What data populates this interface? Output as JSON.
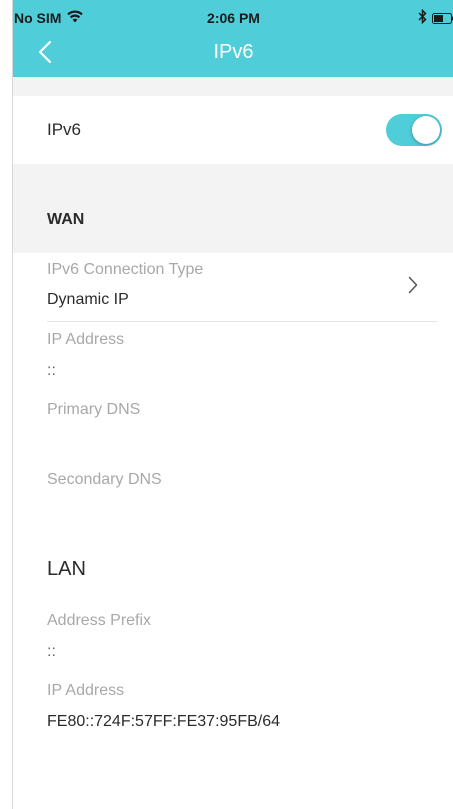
{
  "status_bar": {
    "carrier": "No SIM",
    "time": "2:06 PM",
    "icons": [
      "wifi-icon",
      "bluetooth-icon",
      "battery-icon"
    ]
  },
  "nav": {
    "back_icon": "chevron-left-icon",
    "title": "IPv6"
  },
  "ipv6_toggle": {
    "label": "IPv6",
    "enabled": true
  },
  "wan": {
    "title": "WAN",
    "connection_type": {
      "label": "IPv6 Connection Type",
      "value": "Dynamic IP"
    },
    "ip_address": {
      "label": "IP Address",
      "value": "::"
    },
    "primary_dns": {
      "label": "Primary DNS",
      "value": ""
    },
    "secondary_dns": {
      "label": "Secondary DNS",
      "value": ""
    }
  },
  "lan": {
    "title": "LAN",
    "address_prefix": {
      "label": "Address Prefix",
      "value": "::"
    },
    "ip_address": {
      "label": "IP Address",
      "value": "FE80::724F:57FF:FE37:95FB/64"
    }
  },
  "colors": {
    "accent": "#4fcdd8",
    "section_bg": "#f3f3f3",
    "label_gray": "#a8a8a8",
    "text_dark": "#2b2b2b"
  }
}
